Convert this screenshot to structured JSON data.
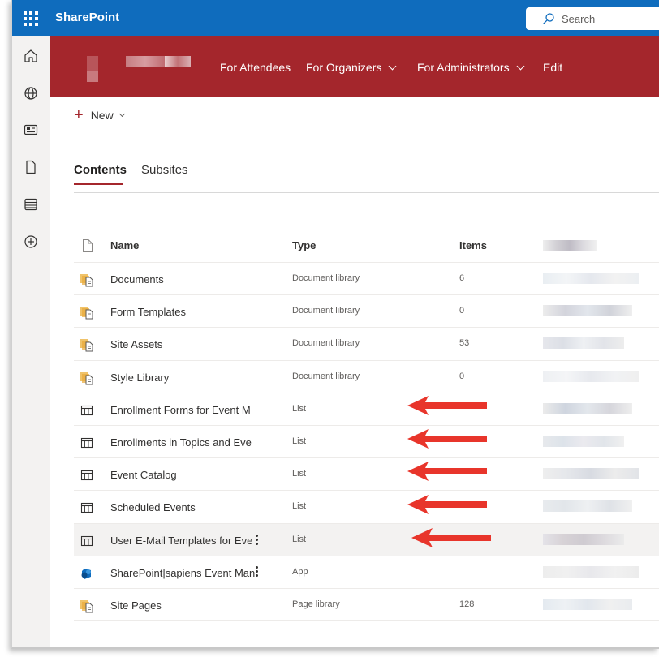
{
  "suite": {
    "app_title": "SharePoint",
    "search_placeholder": "Search"
  },
  "rail": {
    "icons": [
      "home-icon",
      "globe-icon",
      "news-icon",
      "file-icon",
      "lists-icon",
      "add-icon"
    ]
  },
  "hub_nav": {
    "links": [
      {
        "label": "For Attendees",
        "dropdown": false
      },
      {
        "label": "For Organizers",
        "dropdown": true
      },
      {
        "label": "For Administrators",
        "dropdown": true
      },
      {
        "label": "Edit",
        "dropdown": false
      }
    ],
    "accent_color": "#a4262c"
  },
  "command_bar": {
    "new_label": "New"
  },
  "tabs": [
    {
      "label": "Contents",
      "active": true
    },
    {
      "label": "Subsites",
      "active": false
    }
  ],
  "table": {
    "headers": {
      "name": "Name",
      "type": "Type",
      "items": "Items"
    },
    "rows": [
      {
        "icon": "library-icon",
        "name": "Documents",
        "type": "Document library",
        "items": "6"
      },
      {
        "icon": "library-icon",
        "name": "Form Templates",
        "type": "Document library",
        "items": "0"
      },
      {
        "icon": "library-icon",
        "name": "Site Assets",
        "type": "Document library",
        "items": "53"
      },
      {
        "icon": "library-icon",
        "name": "Style Library",
        "type": "Document library",
        "items": "0"
      },
      {
        "icon": "list-icon",
        "name": "Enrollment Forms for Event M",
        "type": "List",
        "items": ""
      },
      {
        "icon": "list-icon",
        "name": "Enrollments in Topics and Eve",
        "type": "List",
        "items": ""
      },
      {
        "icon": "list-icon",
        "name": "Event Catalog",
        "type": "List",
        "items": ""
      },
      {
        "icon": "list-icon",
        "name": "Scheduled Events",
        "type": "List",
        "items": ""
      },
      {
        "icon": "list-icon",
        "name": "User E-Mail Templates for Eve",
        "type": "List",
        "items": ""
      },
      {
        "icon": "app-icon",
        "name": "SharePoint|sapiens Event Man",
        "type": "App",
        "items": ""
      },
      {
        "icon": "library-icon",
        "name": "Site Pages",
        "type": "Page library",
        "items": "128"
      }
    ],
    "highlight_arrow_color": "#e8352b"
  }
}
